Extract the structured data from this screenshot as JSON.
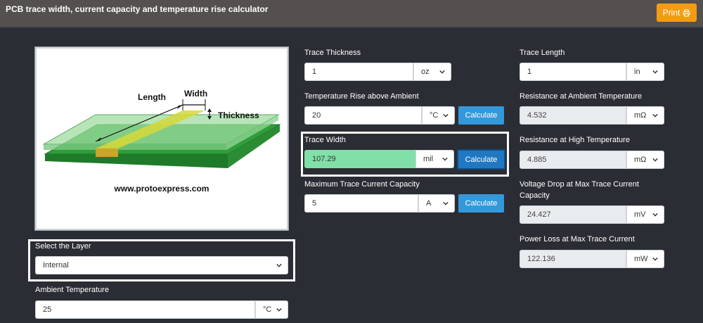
{
  "header": {
    "title": "PCB trace width, current capacity and temperature rise calculator",
    "print_label": "Print"
  },
  "figure": {
    "length_label": "Length",
    "width_label": "Width",
    "thickness_label": "Thickness",
    "url": "www.protoexpress.com"
  },
  "layer": {
    "label": "Select the Layer",
    "value": "Internal"
  },
  "ambient": {
    "label": "Ambient Temperature",
    "value": "25",
    "unit": "°C"
  },
  "thickness": {
    "label": "Trace Thickness",
    "value": "1",
    "unit": "oz"
  },
  "temp_rise": {
    "label": "Temperature Rise above Ambient",
    "value": "20",
    "unit": "°C",
    "button": "Calculate"
  },
  "trace_width": {
    "label": "Trace Width",
    "value": "107.29",
    "unit": "mil",
    "button": "Calculate"
  },
  "max_current": {
    "label": "Maximum Trace Current Capacity",
    "value": "5",
    "unit": "A",
    "button": "Calculate"
  },
  "length": {
    "label": "Trace Length",
    "value": "1",
    "unit": "in"
  },
  "res_ambient": {
    "label": "Resistance at Ambient Temperature",
    "value": "4.532",
    "unit": "mΩ"
  },
  "res_high": {
    "label": "Resistance at High Temperature",
    "value": "4.885",
    "unit": "mΩ"
  },
  "voltage_drop": {
    "label_line1": "Voltage Drop at Max Trace Current",
    "label_line2": "Capacity",
    "value": "24.427",
    "unit": "mV"
  },
  "power_loss": {
    "label": "Power Loss at Max Trace Current",
    "value": "122.136",
    "unit": "mW"
  }
}
